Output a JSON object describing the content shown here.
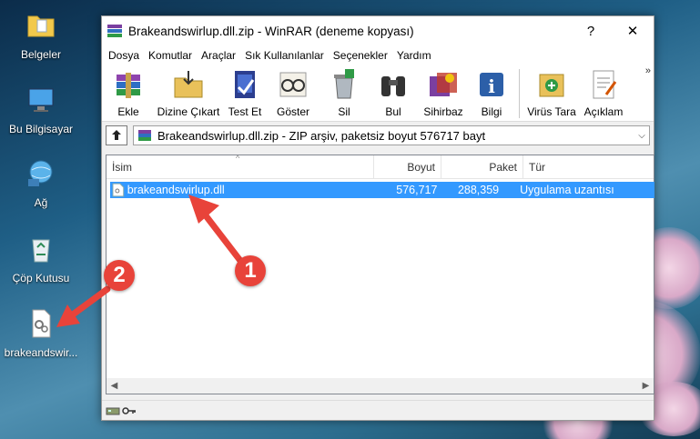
{
  "desktop": {
    "icons": [
      {
        "label": "Belgeler",
        "icon": "folder-icon"
      },
      {
        "label": "Bu Bilgisayar",
        "icon": "computer-icon"
      },
      {
        "label": "Ağ",
        "icon": "network-icon"
      },
      {
        "label": "Çöp Kutusu",
        "icon": "recycle-bin-icon"
      },
      {
        "label": "brakeandswir...",
        "icon": "dll-file-icon"
      }
    ]
  },
  "window": {
    "title": "Brakeandswirlup.dll.zip - WinRAR (deneme kopyası)",
    "help_btn": "?",
    "close_btn": "✕"
  },
  "menu": [
    "Dosya",
    "Komutlar",
    "Araçlar",
    "Sık Kullanılanlar",
    "Seçenekler",
    "Yardım"
  ],
  "toolbar": [
    "Ekle",
    "Dizine Çıkart",
    "Test Et",
    "Göster",
    "Sil",
    "Bul",
    "Sihirbaz",
    "Bilgi",
    "Virüs Tara",
    "Açıklam"
  ],
  "toolbar_more": "»",
  "path": {
    "text": "Brakeandswirlup.dll.zip - ZIP arşiv, paketsiz boyut 576717 bayt",
    "dropdown": "⌵"
  },
  "columns": {
    "name": "İsim",
    "size": "Boyut",
    "packed": "Paket",
    "type": "Tür"
  },
  "sort_indicator": "^",
  "files": [
    {
      "name": "brakeandswirlup.dll",
      "size": "576,717",
      "packed": "288,359",
      "type": "Uygulama uzantısı"
    }
  ],
  "scroll": {
    "left": "◀",
    "right": "▶"
  },
  "callouts": [
    "1",
    "2"
  ],
  "colors": {
    "selection": "#3399ff",
    "callout": "#e8433a"
  }
}
